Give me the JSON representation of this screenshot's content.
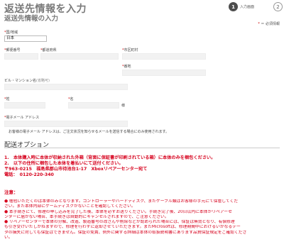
{
  "header": {
    "title": "返送先情報を入力",
    "subtitle": "返送先情報の入力",
    "step1_number": "1",
    "step1_label": "入力画面",
    "step2_number": "2"
  },
  "form": {
    "required_note_star": "*",
    "required_note_text": "＝ 必須情報",
    "country_label": "国/地域",
    "country_value": "日本",
    "postal_label": "郵便番号",
    "prefecture_label": "都道府県",
    "city_label": "市区町村",
    "address_label": "番地",
    "building_label": "ビル・マンション名",
    "building_sub": "(省略可)",
    "lastname_label": "姓",
    "firstname_label": "名",
    "honorific": "様",
    "email_label": "電子メール アドレス",
    "email_note": "お客様の電子メール アドレスは、ご注文状況を知らせるメールを送信する場合にのみ使用されます。",
    "star": "*"
  },
  "delivery": {
    "section_title": "配送オプション",
    "line1": "1.　本体購入時に本体が収納された外箱（背面に保証書が印刷されている箱）に本体のみを梱包ください。",
    "line2": "2.　以下の住所に梱包した本体を着払いにて送付ください。",
    "line3": "〒963-0215　福島県郡山市待池台1-17　Xboxリペアーセンター宛て",
    "line4": "電話：　0120-220-340",
    "warning_title": "注意：",
    "warnings": [
      "● 梱包いただくのは本体のみとなります。コントローラーやハードディスク、またケーブル類はお客様の手元にて保管してくだ",
      "さい。また本体内部にゲームディスクがないことを確認してください。",
      "● 本手続きにて、修理の申し込みを完了した後、本体を必ずお送りください。手続き完了後、20日以内に本体がリペアーセ",
      "ンターに届かない場合、本手続きは自動的にキャンセルされますので、ご注意ください。",
      "● リペアーセンターで本体の分解、改造、製造番号の改ざんや削除などが認められた場合には、保証は無効となり、有償修理",
      "も引き受けいたしかねますので、修理を行わずに返却させていただきます。またMicrosoftは、修理期間中におけるいかなるデー",
      "タの損失に対しても保証はできません。保証の免責、例外に関する詳細は本体の取扱説明書にあります品質保証規定をご確認くださ",
      "い。"
    ]
  }
}
